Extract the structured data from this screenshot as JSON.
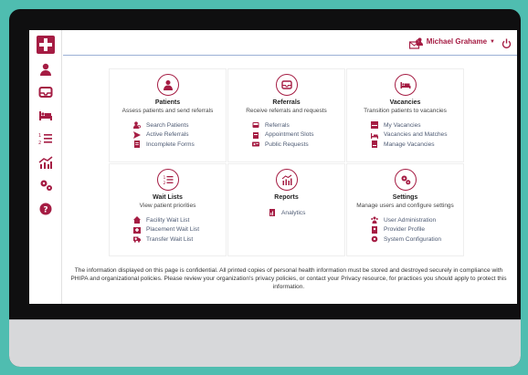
{
  "user": {
    "name": "Michael Grahame",
    "notification_count": "3"
  },
  "colors": {
    "brand": "#a51c43",
    "link": "#4d5a73",
    "page_bg": "#4fbdb0"
  },
  "sidebar": {
    "items": [
      {
        "icon": "person-icon"
      },
      {
        "icon": "inbox-icon"
      },
      {
        "icon": "bed-icon"
      },
      {
        "icon": "list-ordered-icon"
      },
      {
        "icon": "analytics-icon"
      },
      {
        "icon": "gears-icon"
      },
      {
        "icon": "help-icon"
      }
    ]
  },
  "cards": {
    "patients": {
      "title": "Patients",
      "subtitle": "Assess patients and send referrals",
      "links": [
        "Search Patients",
        "Active Referrals",
        "Incomplete Forms"
      ]
    },
    "referrals": {
      "title": "Referrals",
      "subtitle": "Receive referrals and requests",
      "links": [
        "Referrals",
        "Appointment Slots",
        "Public Requests"
      ]
    },
    "vacancies": {
      "title": "Vacancies",
      "subtitle": "Transition patients to vacancies",
      "links": [
        "My Vacancies",
        "Vacancies and Matches",
        "Manage Vacancies"
      ]
    },
    "waitlists": {
      "title": "Wait Lists",
      "subtitle": "View patient priorities",
      "links": [
        "Facility Wait List",
        "Placement Wait List",
        "Transfer Wait List"
      ]
    },
    "reports": {
      "title": "Reports",
      "subtitle": "",
      "links": [
        "Analytics"
      ]
    },
    "settings": {
      "title": "Settings",
      "subtitle": "Manage users and configure settings",
      "links": [
        "User Administration",
        "Provider Profile",
        "System Configuration"
      ]
    }
  },
  "footer": "The information displayed on this page is confidential. All printed copies of personal health information must be stored and destroyed securely in compliance with PHIPA and organizational policies. Please review your organization's privacy policies, or contact your Privacy resource, for practices you should apply to protect this information."
}
